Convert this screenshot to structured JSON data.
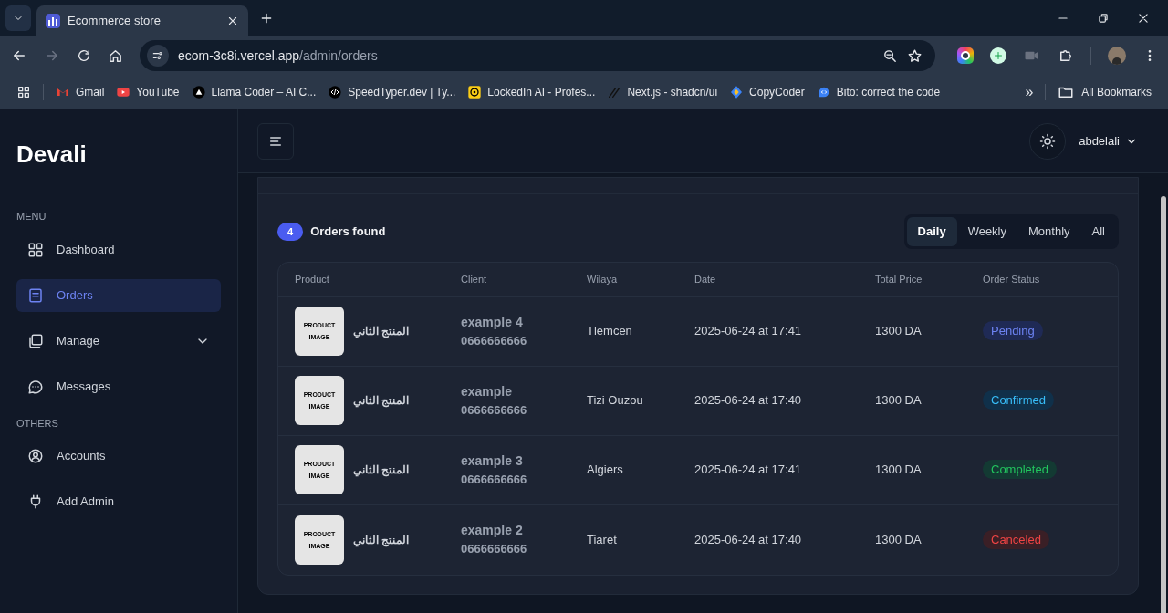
{
  "browser": {
    "tab_title": "Ecommerce store",
    "url_host": "ecom-3c8i.vercel.app",
    "url_path": "/admin/orders",
    "bookmarks": [
      {
        "label": "Gmail",
        "kind": "gmail"
      },
      {
        "label": "YouTube",
        "kind": "youtube"
      },
      {
        "label": "Llama Coder – AI C...",
        "kind": "llama"
      },
      {
        "label": "SpeedTyper.dev | Ty...",
        "kind": "code"
      },
      {
        "label": "LockedIn AI - Profes...",
        "kind": "target"
      },
      {
        "label": "Next.js - shadcn/ui",
        "kind": "slash"
      },
      {
        "label": "CopyCoder",
        "kind": "diamond"
      },
      {
        "label": "Bito: correct the code",
        "kind": "chat"
      }
    ],
    "overflow": "»",
    "all_bookmarks": "All Bookmarks"
  },
  "sidebar": {
    "logo": "Devali",
    "sections": [
      {
        "title": "MENU",
        "items": [
          {
            "label": "Dashboard",
            "kind": "grid",
            "selected": false
          },
          {
            "label": "Orders",
            "kind": "list",
            "selected": true
          },
          {
            "label": "Manage",
            "kind": "copy",
            "selected": false,
            "expanded": false
          },
          {
            "label": "Messages",
            "kind": "chat",
            "selected": false
          }
        ]
      },
      {
        "title": "OTHERS",
        "items": [
          {
            "label": "Accounts",
            "kind": "user",
            "selected": false
          },
          {
            "label": "Add Admin",
            "kind": "plug",
            "selected": false
          }
        ]
      }
    ]
  },
  "header": {
    "user": "abdelali"
  },
  "orders": {
    "count": "4",
    "title": "Orders found",
    "periods": [
      {
        "label": "Daily",
        "selected": true
      },
      {
        "label": "Weekly",
        "selected": false
      },
      {
        "label": "Monthly",
        "selected": false
      },
      {
        "label": "All",
        "selected": false
      }
    ],
    "columns": [
      "Product",
      "Client",
      "Wilaya",
      "Date",
      "Total Price",
      "Order Status"
    ],
    "rows": [
      {
        "image_label": "PRODUCT IMAGE",
        "product": "المنتج الثاني",
        "client": "example 4",
        "phone": "0666666666",
        "wilaya": "Tlemcen",
        "date": "2025-06-24 at 17:41",
        "price": "1300 DA",
        "status": "Pending",
        "kind": "pending"
      },
      {
        "image_label": "PRODUCT IMAGE",
        "product": "المنتج الثاني",
        "client": "example",
        "phone": "0666666666",
        "wilaya": "Tizi Ouzou",
        "date": "2025-06-24 at 17:40",
        "price": "1300 DA",
        "status": "Confirmed",
        "kind": "confirmed"
      },
      {
        "image_label": "PRODUCT IMAGE",
        "product": "المنتج الثاني",
        "client": "example 3",
        "phone": "0666666666",
        "wilaya": "Algiers",
        "date": "2025-06-24 at 17:41",
        "price": "1300 DA",
        "status": "Completed",
        "kind": "completed"
      },
      {
        "image_label": "PRODUCT IMAGE",
        "product": "المنتج الثاني",
        "client": "example 2",
        "phone": "0666666666",
        "wilaya": "Tiaret",
        "date": "2025-06-24 at 17:40",
        "price": "1300 DA",
        "status": "Canceled",
        "kind": "canceled"
      }
    ]
  }
}
